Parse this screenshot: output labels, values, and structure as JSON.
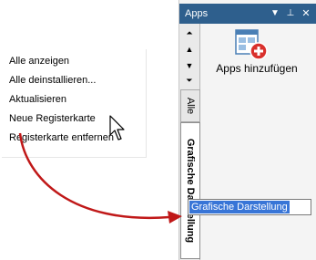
{
  "context_menu": {
    "items": [
      "Alle anzeigen",
      "Alle deinstallieren...",
      "Aktualisieren",
      "Neue Registerkarte",
      "Registerkarte entfernen"
    ]
  },
  "panel": {
    "title": "Apps",
    "header_icons": [
      "dropdown-icon",
      "pin-icon",
      "close-icon"
    ],
    "header_glyphs": {
      "dropdown": "▼",
      "pin": "⊥",
      "close": "✕"
    },
    "nav_glyphs": {
      "first": "⏶",
      "up": "▲",
      "down": "▼",
      "last": "⏷"
    },
    "tabs": [
      {
        "label": "Alle"
      },
      {
        "label": "Grafische Darstellung"
      }
    ],
    "app_tile": {
      "label": "Apps hinzufügen",
      "icon": "add-app-icon"
    }
  },
  "rename_field": {
    "value": "Grafische Darstellung"
  },
  "colors": {
    "header": "#2e5f8d",
    "arrow": "#c01818",
    "selection": "#3875d7",
    "plus_badge": "#d9302c"
  }
}
